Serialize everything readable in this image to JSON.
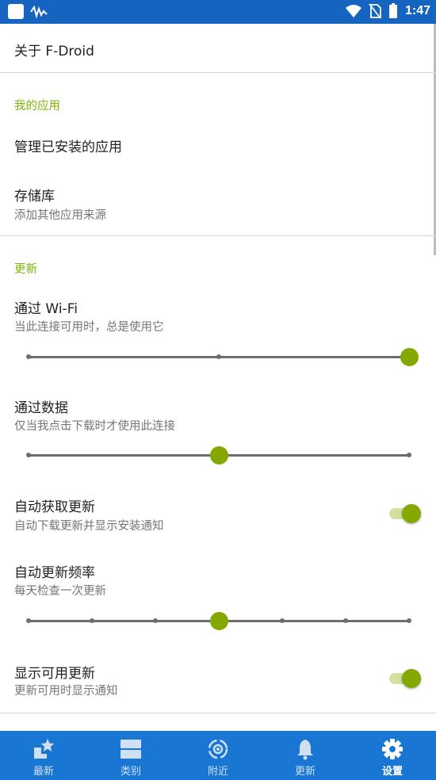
{
  "status_bar": {
    "time": "1:47",
    "icons": [
      "app-square-icon",
      "pulse-icon",
      "wifi-icon",
      "no-sim-icon",
      "battery-icon"
    ]
  },
  "about": {
    "title": "关于 F-Droid"
  },
  "my_apps": {
    "header": "我的应用",
    "manage_installed": "管理已安装的应用",
    "repositories_title": "存储库",
    "repositories_sub": "添加其他应用来源"
  },
  "updates": {
    "header": "更新",
    "wifi": {
      "title": "通过 Wi-Fi",
      "subtitle": "当此连接可用时，总是使用它",
      "value_fraction": 1.0,
      "steps": 3
    },
    "data": {
      "title": "通过数据",
      "subtitle": "仅当我点击下载时才使用此连接",
      "value_fraction": 0.5,
      "steps": 3
    },
    "auto_fetch": {
      "title": "自动获取更新",
      "subtitle": "自动下载更新并显示安装通知",
      "checked": true
    },
    "frequency": {
      "title": "自动更新频率",
      "subtitle": "每天检查一次更新",
      "value_fraction": 0.5,
      "steps": 7
    },
    "show_available": {
      "title": "显示可用更新",
      "subtitle": "更新可用时显示通知",
      "checked": true
    }
  },
  "colors": {
    "primary": "#1565c0",
    "nav": "#1976d2",
    "accent": "#85a800",
    "section_header": "#7cb305"
  },
  "bottom_nav": {
    "items": [
      {
        "label": "最新",
        "icon": "star-new-icon",
        "active": false
      },
      {
        "label": "类别",
        "icon": "categories-icon",
        "active": false
      },
      {
        "label": "附近",
        "icon": "nearby-icon",
        "active": false
      },
      {
        "label": "更新",
        "icon": "bell-icon",
        "active": false
      },
      {
        "label": "设置",
        "icon": "gear-icon",
        "active": true
      }
    ]
  }
}
